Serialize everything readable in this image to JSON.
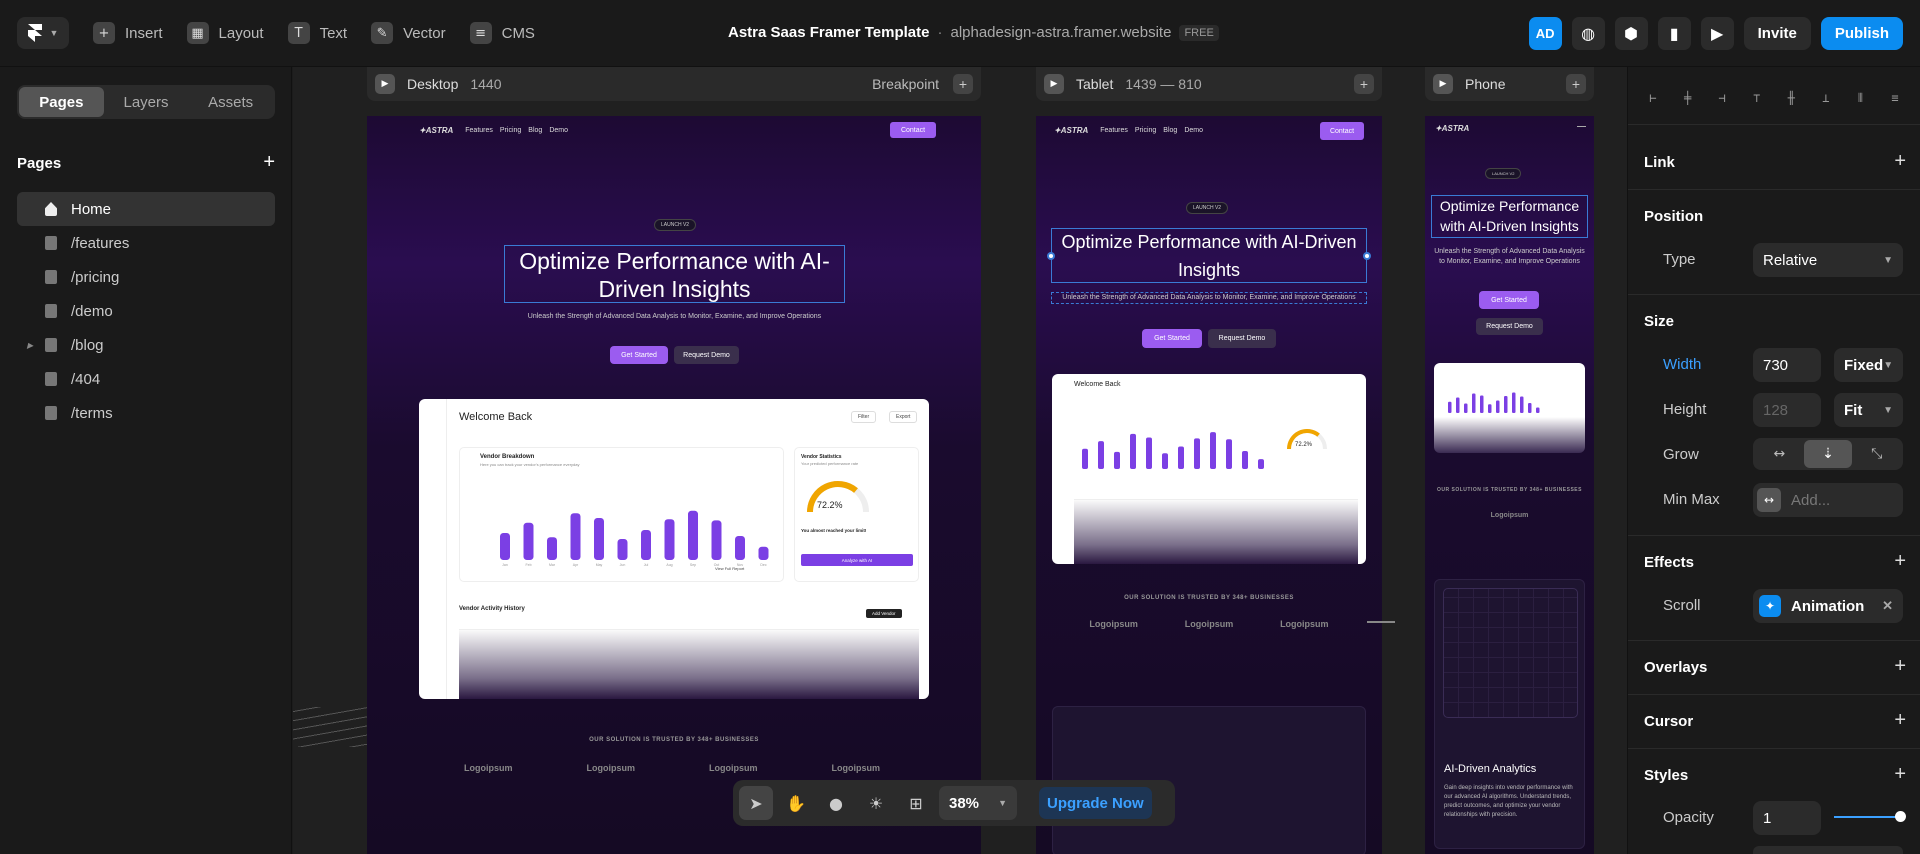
{
  "topbar": {
    "insert": "Insert",
    "layout": "Layout",
    "text": "Text",
    "vector": "Vector",
    "cms": "CMS",
    "project_title": "Astra Saas Framer Template",
    "separator": "·",
    "url": "alphadesign-astra.framer.website",
    "free_badge": "FREE",
    "avatar": "AD",
    "invite": "Invite",
    "publish": "Publish"
  },
  "left": {
    "tabs": [
      "Pages",
      "Layers",
      "Assets"
    ],
    "active_tab": "Pages",
    "pages_heading": "Pages",
    "pages": [
      "Home",
      "/features",
      "/pricing",
      "/demo",
      "/blog",
      "/404",
      "/terms"
    ],
    "selected_page": "Home"
  },
  "breakpoints": {
    "desktop": {
      "name": "Desktop",
      "size": "1440",
      "label": "Breakpoint"
    },
    "tablet": {
      "name": "Tablet",
      "size": "1439 — 810"
    },
    "phone": {
      "name": "Phone"
    }
  },
  "site": {
    "brand": "✦ASTRA",
    "nav": [
      "Features",
      "Pricing",
      "Blog",
      "Demo"
    ],
    "contact": "Contact",
    "launch": "LAUNCH V2",
    "headline": "Optimize Performance with AI-Driven Insights",
    "subtitle": "Unleash the Strength of Advanced Data Analysis to Monitor, Examine, and Improve Operations",
    "cta_primary": "Get Started",
    "cta_secondary": "Request Demo",
    "trusted": "OUR SOLUTION IS TRUSTED BY 348+ BUSINESSES",
    "logo": "Logoipsum",
    "dashboard": {
      "welcome": "Welcome Back",
      "filter": "Filter",
      "export": "Export",
      "vendor_breakdown": "Vendor Breakdown",
      "vendor_breakdown_sub": "Here you can track your vendor's performance everyday",
      "vendor_stats": "Vendor Statistics",
      "vendor_stats_sub": "Your predicted performance rate",
      "gauge_value": "72.2%",
      "gauge_fraction": 0.722,
      "limit_text": "You almost reached your limit!",
      "analyze": "Analyze with AI",
      "view_full": "View Full Report",
      "activity": "Vendor Activity History",
      "add_vendor": "Add Vendor",
      "bars": [
        0.45,
        0.62,
        0.38,
        0.78,
        0.7,
        0.35,
        0.5,
        0.68,
        0.82,
        0.66,
        0.4,
        0.22
      ],
      "months": [
        "Jan",
        "Feb",
        "Mar",
        "Apr",
        "May",
        "Jun",
        "Jul",
        "Aug",
        "Sep",
        "Oct",
        "Nov",
        "Dec"
      ]
    },
    "phone_feature_title": "AI-Driven Analytics",
    "phone_feature_body": "Gain deep insights into vendor performance with our advanced AI algorithms. Understand trends, predict outcomes, and optimize your vendor relationships with precision."
  },
  "bottom": {
    "zoom": "38%",
    "upgrade": "Upgrade Now"
  },
  "right": {
    "link": "Link",
    "position": "Position",
    "type_label": "Type",
    "type_value": "Relative",
    "size": "Size",
    "width_label": "Width",
    "width_value": "730",
    "width_mode": "Fixed",
    "height_label": "Height",
    "height_placeholder": "128",
    "height_mode": "Fit",
    "grow_label": "Grow",
    "minmax_label": "Min Max",
    "minmax_placeholder": "Add...",
    "effects": "Effects",
    "scroll_label": "Scroll",
    "scroll_value": "Animation",
    "overlays": "Overlays",
    "cursor": "Cursor",
    "styles": "Styles",
    "opacity_label": "Opacity",
    "opacity_value": "1"
  },
  "colors": {
    "accent": "#0b8cf0",
    "purple": "#9b5cf0",
    "selection": "#3a7bd5"
  }
}
